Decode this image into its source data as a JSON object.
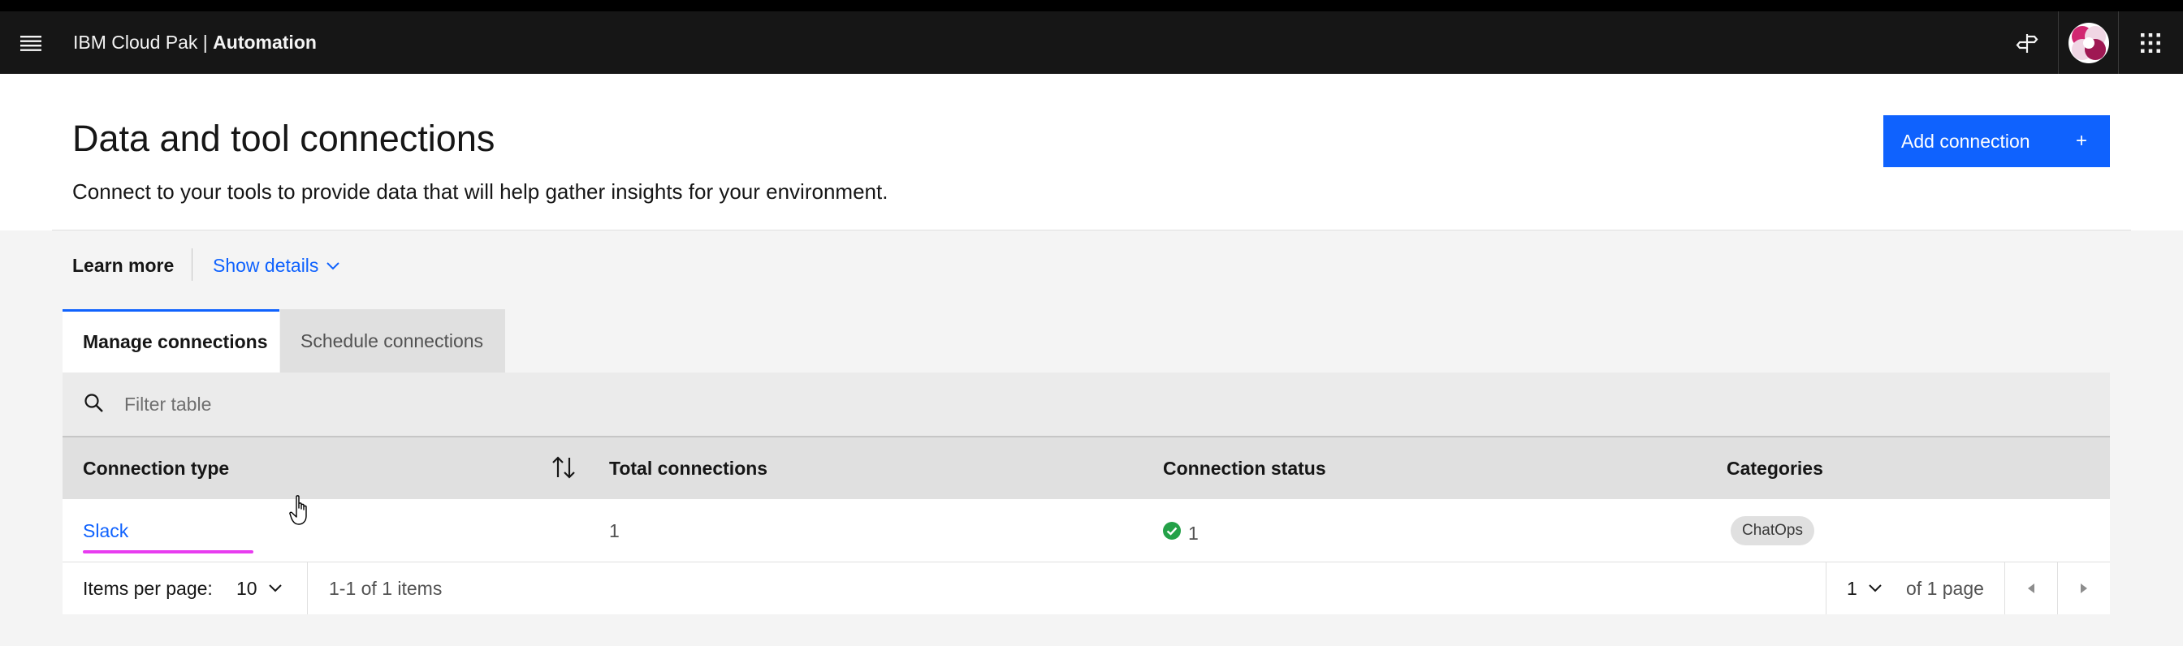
{
  "header": {
    "product_prefix": "IBM Cloud Pak | ",
    "product_name": "Automation"
  },
  "page": {
    "title": "Data and tool connections",
    "subtitle": "Connect to your tools to provide data that will help gather insights for your environment.",
    "add_button_label": "Add connection",
    "add_button_icon": "+"
  },
  "learn": {
    "label": "Learn more",
    "toggle_label": "Show details"
  },
  "tabs": [
    {
      "label": "Manage connections",
      "selected": true
    },
    {
      "label": "Schedule connections",
      "selected": false
    }
  ],
  "search": {
    "placeholder": "Filter table",
    "value": ""
  },
  "table": {
    "columns": [
      "Connection type",
      "Total connections",
      "Connection status",
      "Categories"
    ],
    "rows": [
      {
        "type": "Slack",
        "total": "1",
        "status_count": "1",
        "category": "ChatOps"
      }
    ]
  },
  "pagination": {
    "items_per_page_label": "Items per page:",
    "items_per_page": "10",
    "range": "1-1 of 1 items",
    "page": "1",
    "of_pages": "of 1 page"
  },
  "colors": {
    "accent": "#0f62fe",
    "success": "#24a148",
    "shell": "#161616"
  }
}
